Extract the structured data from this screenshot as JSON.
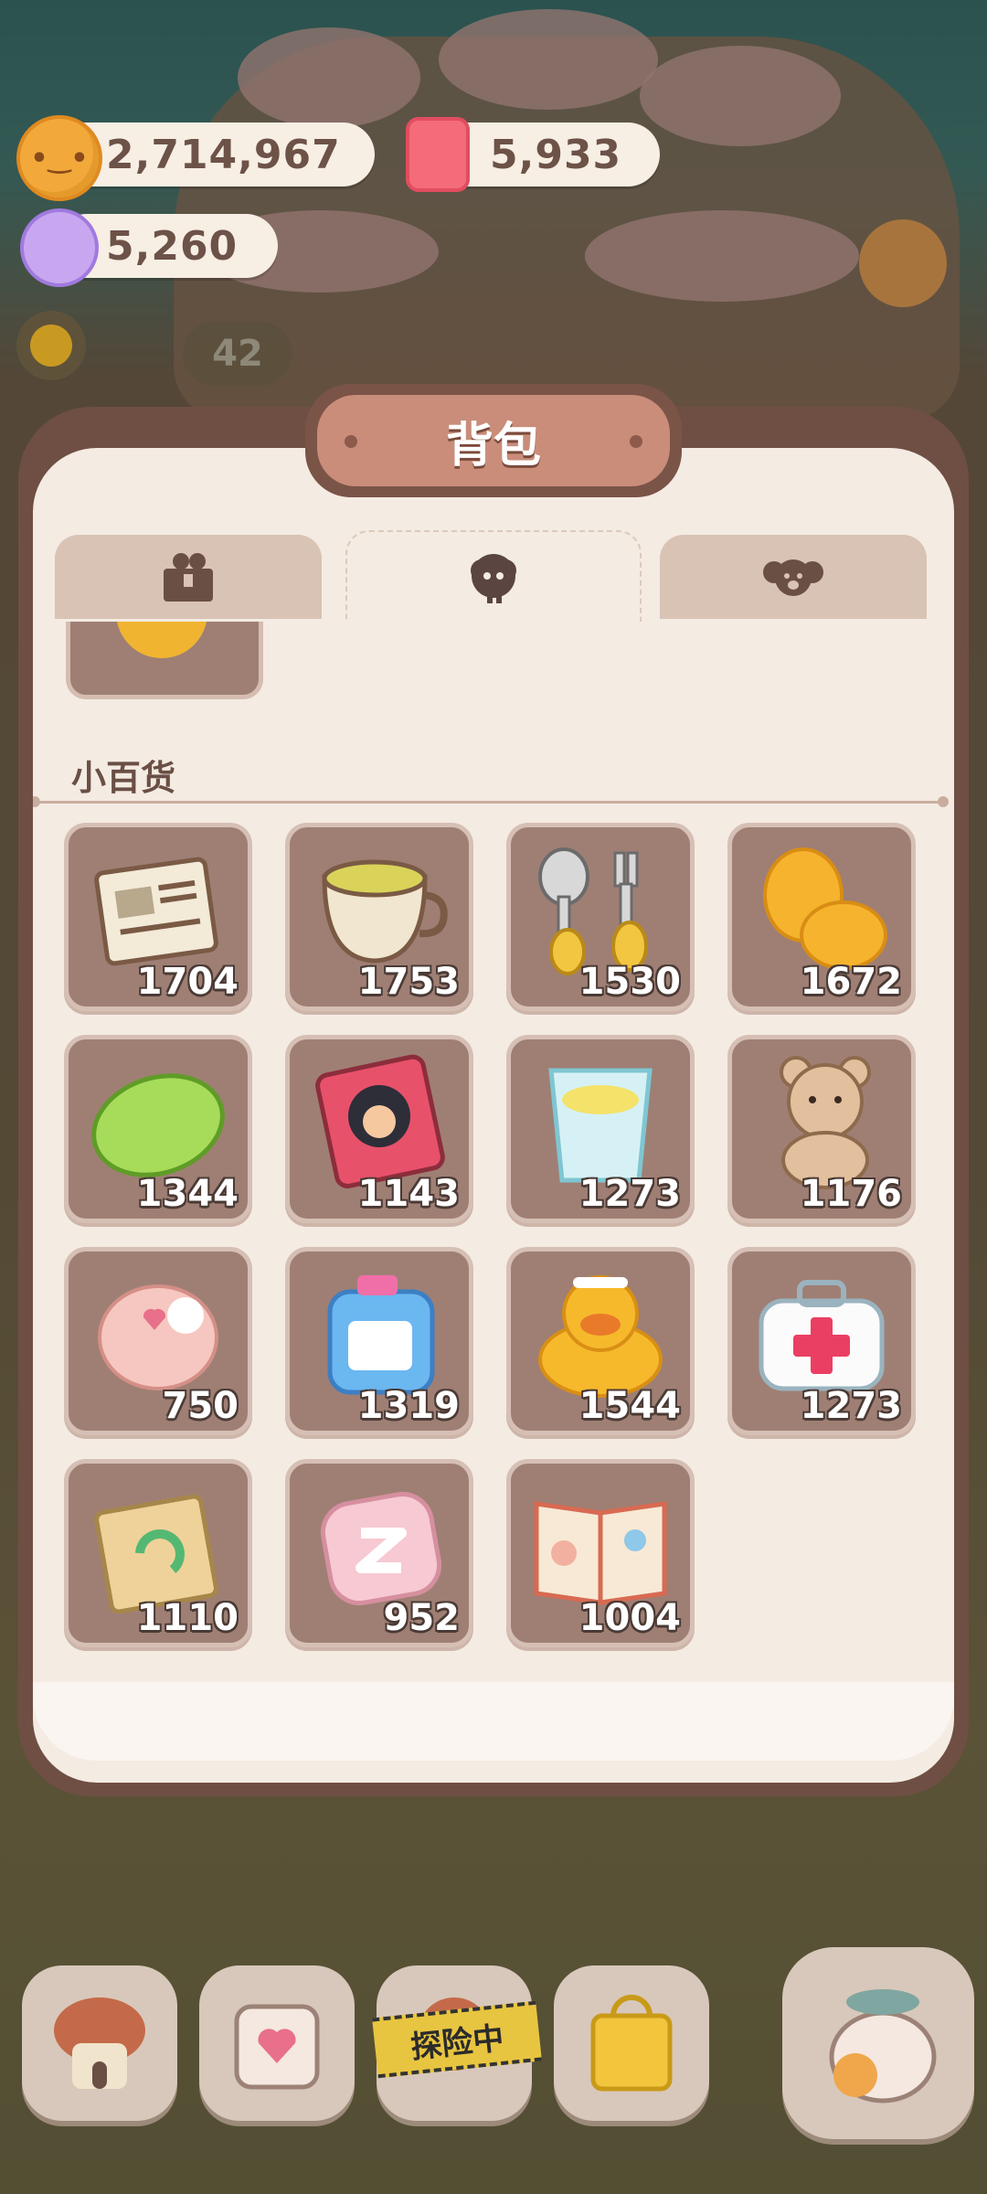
{
  "currencies": {
    "cookies": {
      "value": "2,714,967",
      "icon": "cookie-coin-icon"
    },
    "candles": {
      "value": "5,933",
      "icon": "candle-icon"
    },
    "candy": {
      "value": "5,260",
      "icon": "candy-gem-icon"
    }
  },
  "hud": {
    "badge_value": "42",
    "sun_icon": "sun-icon",
    "flower_icon": "flower-icon"
  },
  "backpack": {
    "title": "背包",
    "tabs": [
      {
        "name": "tab-box",
        "icon": "bear-box-icon",
        "active": false
      },
      {
        "name": "tab-cookie",
        "icon": "cookie-cloud-icon",
        "active": true
      },
      {
        "name": "tab-koala",
        "icon": "koala-icon",
        "active": false
      }
    ],
    "section_title": "小百货",
    "items": [
      {
        "name": "newspaper",
        "icon": "newspaper-icon",
        "count": "1704"
      },
      {
        "name": "tea-cup",
        "icon": "tea-cup-icon",
        "count": "1753"
      },
      {
        "name": "spoon-fork",
        "icon": "spoon-fork-icon",
        "count": "1530"
      },
      {
        "name": "sleep-slippers",
        "icon": "slippers-icon",
        "count": "1672"
      },
      {
        "name": "soap",
        "icon": "soap-icon",
        "count": "1344"
      },
      {
        "name": "storybook",
        "icon": "storybook-icon",
        "count": "1143"
      },
      {
        "name": "lemon-water",
        "icon": "lemon-water-icon",
        "count": "1273"
      },
      {
        "name": "teddy-bear",
        "icon": "teddy-bear-icon",
        "count": "1176"
      },
      {
        "name": "bath-puff",
        "icon": "bath-puff-icon",
        "count": "750"
      },
      {
        "name": "detergent",
        "icon": "detergent-icon",
        "count": "1319"
      },
      {
        "name": "rubber-duck",
        "icon": "rubber-duck-icon",
        "count": "1544"
      },
      {
        "name": "first-aid-kit",
        "icon": "first-aid-kit-icon",
        "count": "1273"
      },
      {
        "name": "recycle-bag",
        "icon": "recycle-bag-icon",
        "count": "1110"
      },
      {
        "name": "pillow",
        "icon": "pillow-icon",
        "count": "952"
      },
      {
        "name": "comic-magazine",
        "icon": "magazine-icon",
        "count": "1004"
      }
    ]
  },
  "bottom_nav": {
    "explore_label": "探险中",
    "items": [
      "house-icon",
      "calendar-heart-icon",
      "explore-icon",
      "shop-bag-icon",
      "fish-character-icon"
    ]
  },
  "colors": {
    "panel_frame": "#6f4f44",
    "panel_bg": "#f4ebe3",
    "slot_bg": "#9f7f74",
    "title_plate": "#c98d7a"
  }
}
